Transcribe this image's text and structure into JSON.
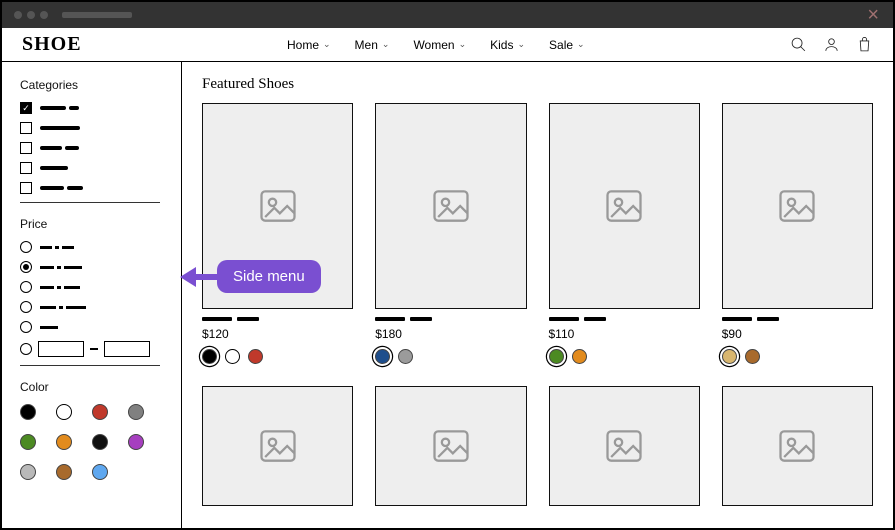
{
  "header": {
    "logo": "SHOE",
    "nav": [
      {
        "label": "Home"
      },
      {
        "label": "Men"
      },
      {
        "label": "Women"
      },
      {
        "label": "Kids"
      },
      {
        "label": "Sale"
      }
    ]
  },
  "sidebar": {
    "categories_title": "Categories",
    "price_title": "Price",
    "color_title": "Color",
    "swatches": [
      "#000000",
      "#ffffff",
      "#c0392b",
      "#808080",
      "#4c8a22",
      "#e28b1d",
      "#111111",
      "#a63fbf",
      "#b9b9b9",
      "#a86a2c",
      "#5fa8f0"
    ]
  },
  "main": {
    "title": "Featured Shoes",
    "products": [
      {
        "price": "$120",
        "colors": [
          "#000000",
          "#ffffff",
          "#c0392b"
        ],
        "ringed": true
      },
      {
        "price": "$180",
        "colors": [
          "#1e4e8c",
          "#9b9b9b"
        ],
        "ringed": true
      },
      {
        "price": "$110",
        "colors": [
          "#4c8a22",
          "#e28b1d"
        ],
        "ringed": true
      },
      {
        "price": "$90",
        "colors": [
          "#d8b66f",
          "#a86a2c"
        ],
        "ringed": true
      }
    ]
  },
  "callout": {
    "text": "Side menu"
  }
}
